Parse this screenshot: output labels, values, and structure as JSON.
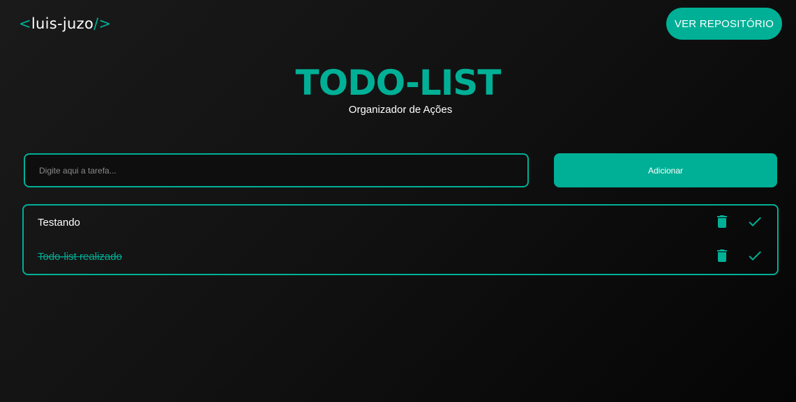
{
  "header": {
    "logo_open": "<",
    "logo_name": "luis-juzo",
    "logo_close": "/>",
    "repo_button_label": "VER REPOSITÓRIO"
  },
  "hero": {
    "title": "TODO-LIST",
    "subtitle": "Organizador de Ações"
  },
  "form": {
    "input_value": "",
    "input_placeholder": "Digite aqui a tarefa...",
    "add_button_label": "Adicionar"
  },
  "tasks": [
    {
      "text": "Testando",
      "completed": false
    },
    {
      "text": "Todo-list realizado",
      "completed": true
    }
  ],
  "icons": {
    "delete": "trash-icon",
    "complete": "check-icon"
  },
  "colors": {
    "accent": "#00b096",
    "background": "#121212",
    "text": "#ffffff",
    "placeholder": "#8a8a8a"
  }
}
